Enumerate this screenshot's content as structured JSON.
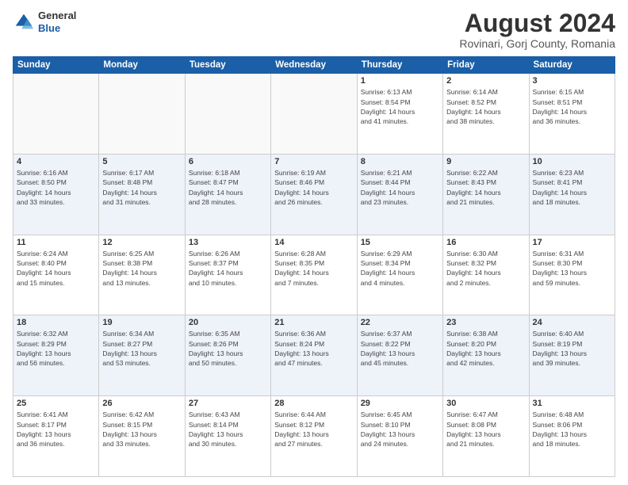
{
  "header": {
    "logo_line1": "General",
    "logo_line2": "Blue",
    "month_year": "August 2024",
    "location": "Rovinari, Gorj County, Romania"
  },
  "days_of_week": [
    "Sunday",
    "Monday",
    "Tuesday",
    "Wednesday",
    "Thursday",
    "Friday",
    "Saturday"
  ],
  "weeks": [
    [
      {
        "day": "",
        "detail": ""
      },
      {
        "day": "",
        "detail": ""
      },
      {
        "day": "",
        "detail": ""
      },
      {
        "day": "",
        "detail": ""
      },
      {
        "day": "1",
        "detail": "Sunrise: 6:13 AM\nSunset: 8:54 PM\nDaylight: 14 hours\nand 41 minutes."
      },
      {
        "day": "2",
        "detail": "Sunrise: 6:14 AM\nSunset: 8:52 PM\nDaylight: 14 hours\nand 38 minutes."
      },
      {
        "day": "3",
        "detail": "Sunrise: 6:15 AM\nSunset: 8:51 PM\nDaylight: 14 hours\nand 36 minutes."
      }
    ],
    [
      {
        "day": "4",
        "detail": "Sunrise: 6:16 AM\nSunset: 8:50 PM\nDaylight: 14 hours\nand 33 minutes."
      },
      {
        "day": "5",
        "detail": "Sunrise: 6:17 AM\nSunset: 8:48 PM\nDaylight: 14 hours\nand 31 minutes."
      },
      {
        "day": "6",
        "detail": "Sunrise: 6:18 AM\nSunset: 8:47 PM\nDaylight: 14 hours\nand 28 minutes."
      },
      {
        "day": "7",
        "detail": "Sunrise: 6:19 AM\nSunset: 8:46 PM\nDaylight: 14 hours\nand 26 minutes."
      },
      {
        "day": "8",
        "detail": "Sunrise: 6:21 AM\nSunset: 8:44 PM\nDaylight: 14 hours\nand 23 minutes."
      },
      {
        "day": "9",
        "detail": "Sunrise: 6:22 AM\nSunset: 8:43 PM\nDaylight: 14 hours\nand 21 minutes."
      },
      {
        "day": "10",
        "detail": "Sunrise: 6:23 AM\nSunset: 8:41 PM\nDaylight: 14 hours\nand 18 minutes."
      }
    ],
    [
      {
        "day": "11",
        "detail": "Sunrise: 6:24 AM\nSunset: 8:40 PM\nDaylight: 14 hours\nand 15 minutes."
      },
      {
        "day": "12",
        "detail": "Sunrise: 6:25 AM\nSunset: 8:38 PM\nDaylight: 14 hours\nand 13 minutes."
      },
      {
        "day": "13",
        "detail": "Sunrise: 6:26 AM\nSunset: 8:37 PM\nDaylight: 14 hours\nand 10 minutes."
      },
      {
        "day": "14",
        "detail": "Sunrise: 6:28 AM\nSunset: 8:35 PM\nDaylight: 14 hours\nand 7 minutes."
      },
      {
        "day": "15",
        "detail": "Sunrise: 6:29 AM\nSunset: 8:34 PM\nDaylight: 14 hours\nand 4 minutes."
      },
      {
        "day": "16",
        "detail": "Sunrise: 6:30 AM\nSunset: 8:32 PM\nDaylight: 14 hours\nand 2 minutes."
      },
      {
        "day": "17",
        "detail": "Sunrise: 6:31 AM\nSunset: 8:30 PM\nDaylight: 13 hours\nand 59 minutes."
      }
    ],
    [
      {
        "day": "18",
        "detail": "Sunrise: 6:32 AM\nSunset: 8:29 PM\nDaylight: 13 hours\nand 56 minutes."
      },
      {
        "day": "19",
        "detail": "Sunrise: 6:34 AM\nSunset: 8:27 PM\nDaylight: 13 hours\nand 53 minutes."
      },
      {
        "day": "20",
        "detail": "Sunrise: 6:35 AM\nSunset: 8:26 PM\nDaylight: 13 hours\nand 50 minutes."
      },
      {
        "day": "21",
        "detail": "Sunrise: 6:36 AM\nSunset: 8:24 PM\nDaylight: 13 hours\nand 47 minutes."
      },
      {
        "day": "22",
        "detail": "Sunrise: 6:37 AM\nSunset: 8:22 PM\nDaylight: 13 hours\nand 45 minutes."
      },
      {
        "day": "23",
        "detail": "Sunrise: 6:38 AM\nSunset: 8:20 PM\nDaylight: 13 hours\nand 42 minutes."
      },
      {
        "day": "24",
        "detail": "Sunrise: 6:40 AM\nSunset: 8:19 PM\nDaylight: 13 hours\nand 39 minutes."
      }
    ],
    [
      {
        "day": "25",
        "detail": "Sunrise: 6:41 AM\nSunset: 8:17 PM\nDaylight: 13 hours\nand 36 minutes."
      },
      {
        "day": "26",
        "detail": "Sunrise: 6:42 AM\nSunset: 8:15 PM\nDaylight: 13 hours\nand 33 minutes."
      },
      {
        "day": "27",
        "detail": "Sunrise: 6:43 AM\nSunset: 8:14 PM\nDaylight: 13 hours\nand 30 minutes."
      },
      {
        "day": "28",
        "detail": "Sunrise: 6:44 AM\nSunset: 8:12 PM\nDaylight: 13 hours\nand 27 minutes."
      },
      {
        "day": "29",
        "detail": "Sunrise: 6:45 AM\nSunset: 8:10 PM\nDaylight: 13 hours\nand 24 minutes."
      },
      {
        "day": "30",
        "detail": "Sunrise: 6:47 AM\nSunset: 8:08 PM\nDaylight: 13 hours\nand 21 minutes."
      },
      {
        "day": "31",
        "detail": "Sunrise: 6:48 AM\nSunset: 8:06 PM\nDaylight: 13 hours\nand 18 minutes."
      }
    ]
  ]
}
